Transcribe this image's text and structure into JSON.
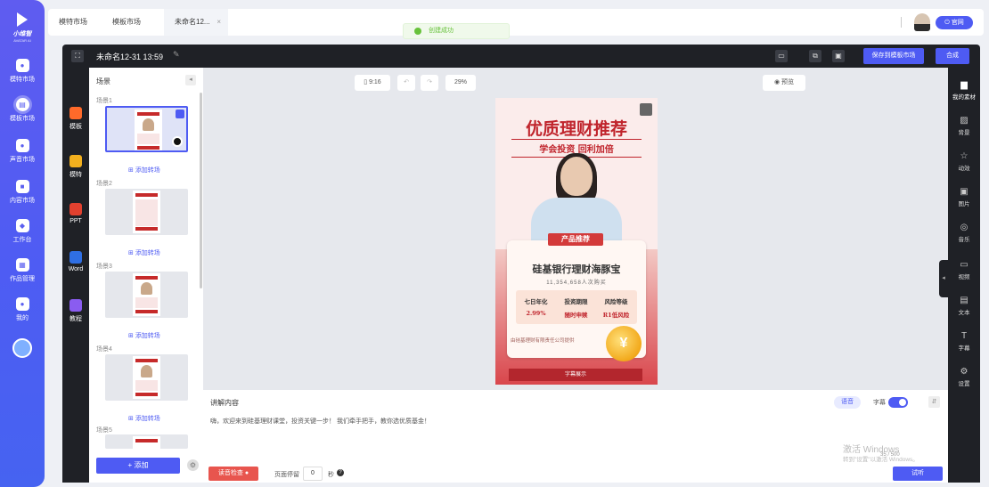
{
  "app": {
    "logo_text": "小维智",
    "logo_sub": "AVATAR AI",
    "nav": [
      {
        "label": "模特市场",
        "icon": "user-icon"
      },
      {
        "label": "模板市场",
        "icon": "template-icon"
      },
      {
        "label": "声音市场",
        "icon": "voice-icon"
      },
      {
        "label": "内容市场",
        "icon": "content-icon"
      },
      {
        "label": "工作台",
        "icon": "workbench-icon"
      },
      {
        "label": "作品管理",
        "icon": "works-icon"
      },
      {
        "label": "我的",
        "icon": "profile-icon"
      }
    ],
    "active_nav": "模板市场"
  },
  "tabs": [
    {
      "label": "模特市场"
    },
    {
      "label": "模板市场"
    },
    {
      "label": "未命名12..."
    }
  ],
  "header_right": {
    "official_label": "官网"
  },
  "toast": {
    "text": "创建成功"
  },
  "toolbar": {
    "project_name": "未命名12-31 13:59",
    "save_template_label": "保存到模板市场",
    "compose_label": "合成"
  },
  "tools": [
    {
      "label": "模板",
      "color": "#ff6a2a"
    },
    {
      "label": "模特",
      "color": "#f2b01e"
    },
    {
      "label": "PPT",
      "color": "#e2412f"
    },
    {
      "label": "Word",
      "color": "#2f6fe4"
    },
    {
      "label": "教程",
      "color": "#8a5cf0"
    }
  ],
  "scenes": {
    "title": "场景",
    "items": [
      {
        "label": "场景1"
      },
      {
        "label": "场景2"
      },
      {
        "label": "场景3"
      },
      {
        "label": "场景4"
      },
      {
        "label": "场景5"
      }
    ],
    "add_transition_label": "添加转场",
    "add_button_label": "+ 添加"
  },
  "canvas": {
    "ratio": "9:16",
    "zoom": "29%",
    "preview_label": "预览"
  },
  "poster": {
    "title": "优质理财推荐",
    "subtitle": "学会投资  回利加倍",
    "badge": "产品推荐",
    "product": "硅基银行理财海豚宝",
    "buyers": "11,354,658人次购买",
    "stats": [
      {
        "label": "七日年化",
        "value": "2.99%"
      },
      {
        "label": "投资期限",
        "value": "随时申赎"
      },
      {
        "label": "风险等级",
        "value": "R1低风险"
      }
    ],
    "provider": "由硅基理财有限责任公司提供",
    "coin_symbol": "¥",
    "footer": "字幕展示"
  },
  "resources": [
    {
      "label": "我的素材",
      "icon": "folder-icon",
      "glyph": "▆"
    },
    {
      "label": "背景",
      "icon": "background-icon",
      "glyph": "▨"
    },
    {
      "label": "动效",
      "icon": "effects-icon",
      "glyph": "☆"
    },
    {
      "label": "图片",
      "icon": "image-icon",
      "glyph": "▣"
    },
    {
      "label": "音乐",
      "icon": "music-icon",
      "glyph": "◎"
    },
    {
      "label": "视频",
      "icon": "video-icon",
      "glyph": "▭"
    },
    {
      "label": "文本",
      "icon": "text-icon",
      "glyph": "▤"
    },
    {
      "label": "字幕",
      "icon": "subtitle-icon",
      "glyph": "T"
    },
    {
      "label": "设置",
      "icon": "settings-icon",
      "glyph": "⚙"
    }
  ],
  "script": {
    "title": "讲解内容",
    "voice_label": "语音",
    "subtitle_label": "字幕",
    "text": "嗨，欢迎来到硅基理财课堂，投资关键一步！ 我们牵手把手，教你选优质基金！",
    "char_count": "35 / 500",
    "check_label": "读音检查",
    "pause_label": "页面停留",
    "pause_value": "0",
    "pause_unit": "秒",
    "listen_label": "试听"
  },
  "watermark": {
    "line1": "激活 Windows",
    "line2": "转到\"设置\"以激活 Windows。"
  }
}
